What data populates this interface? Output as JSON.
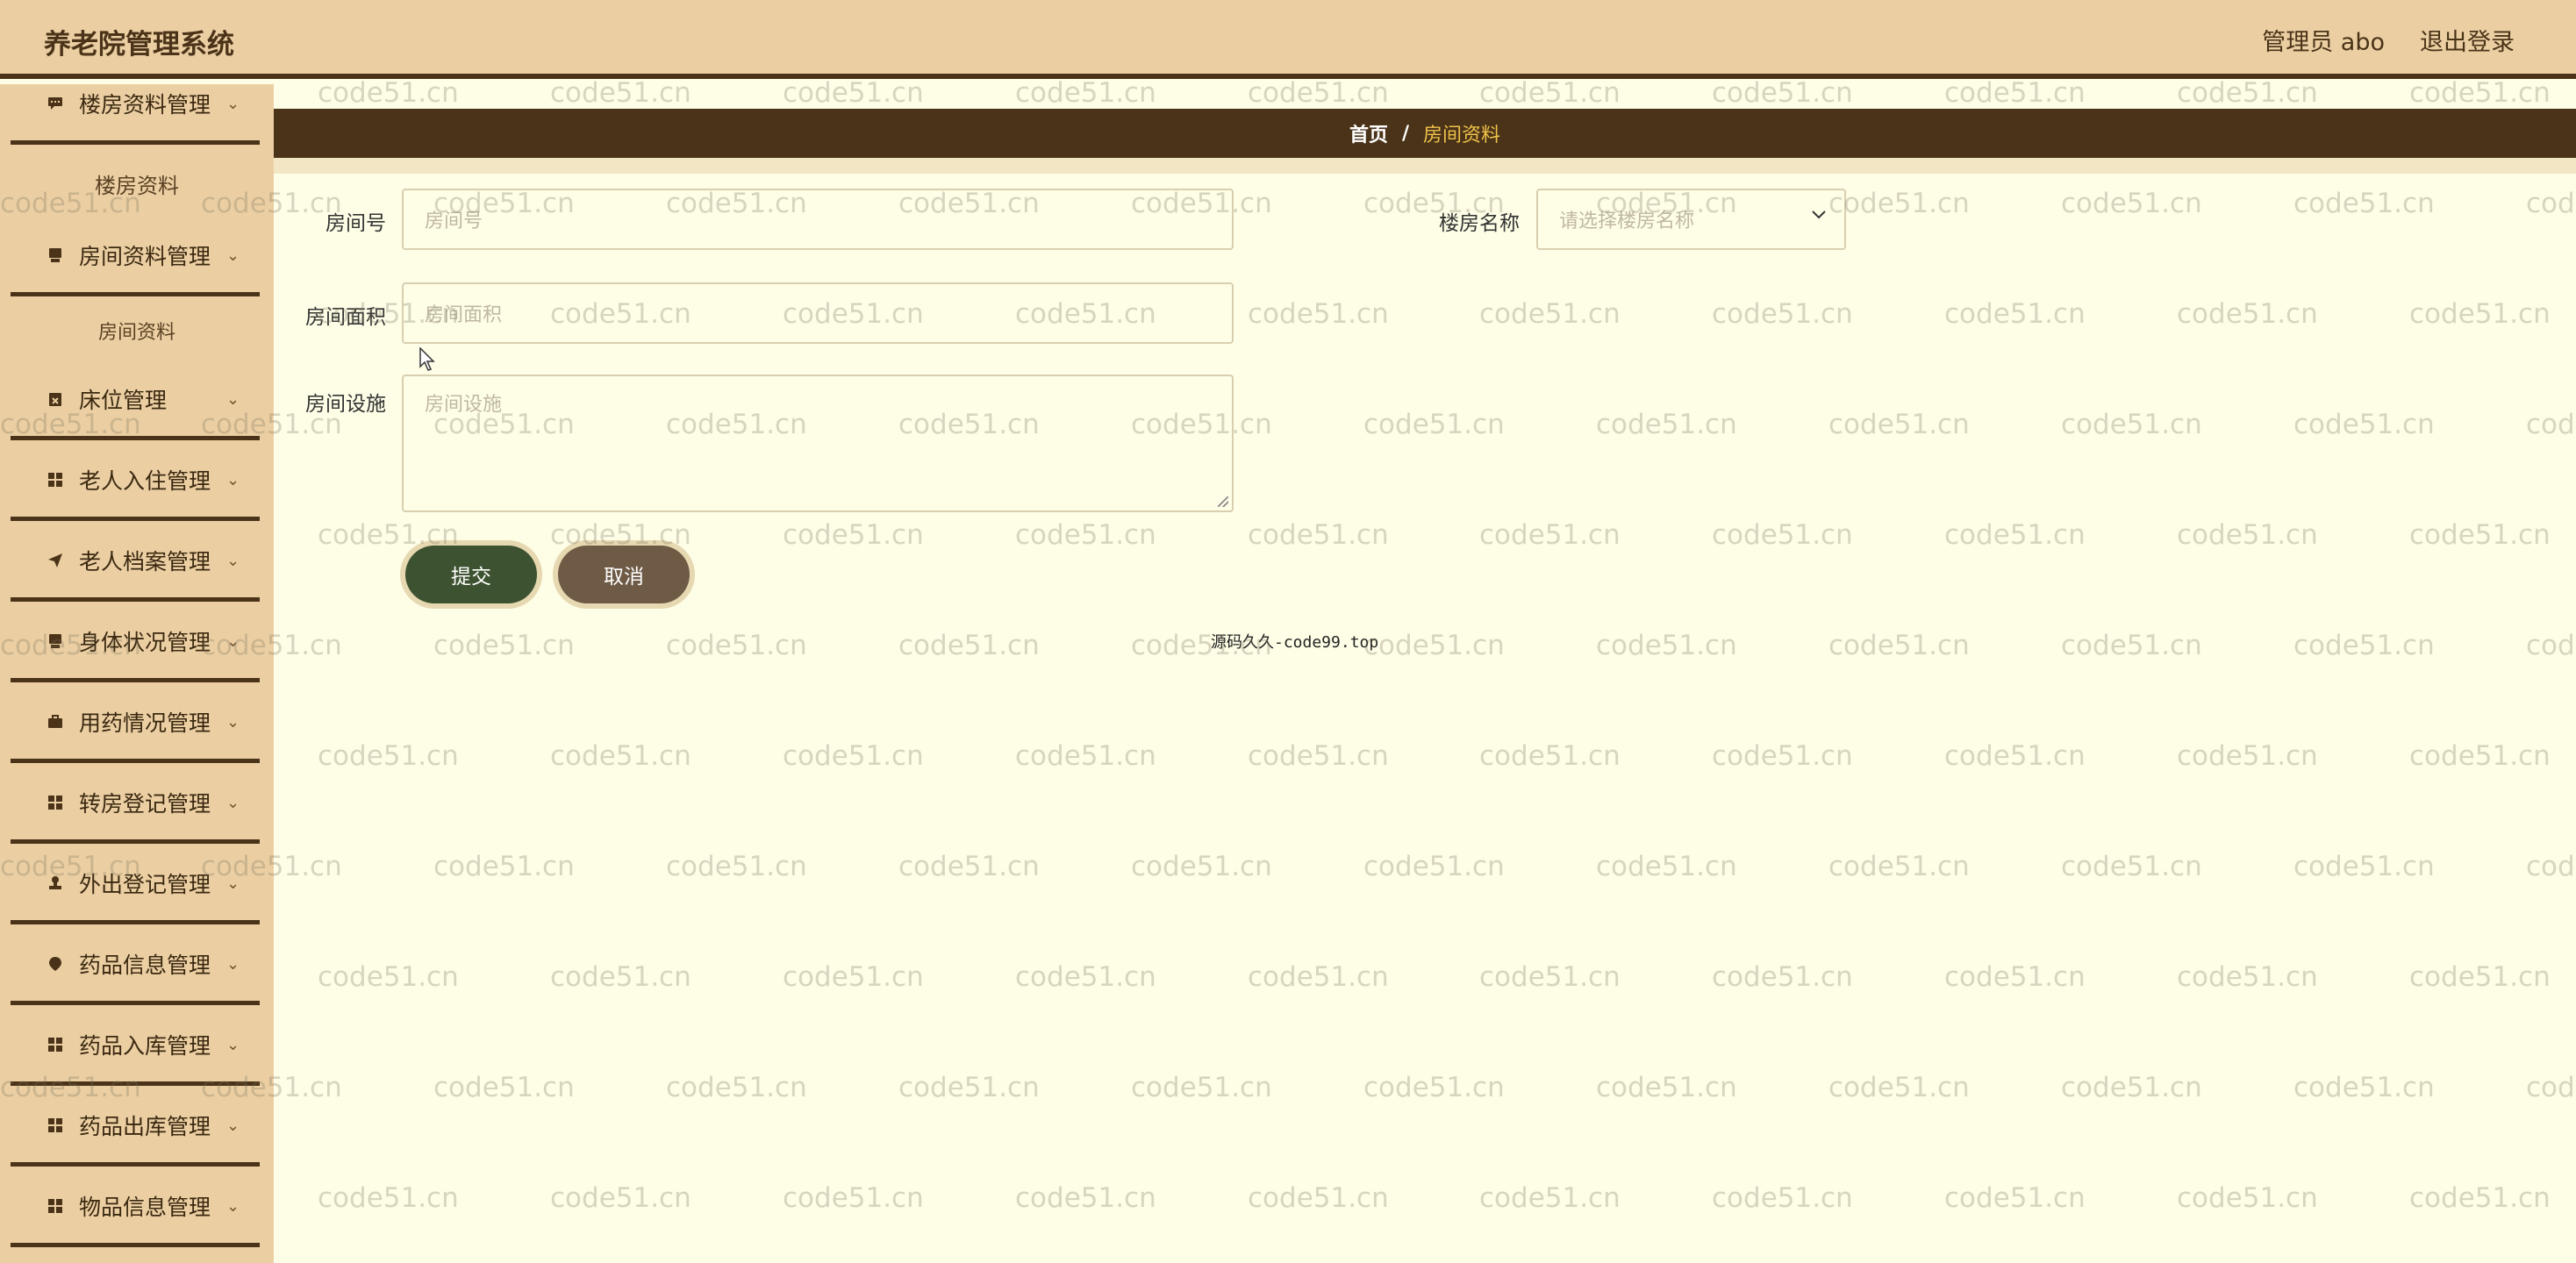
{
  "app": {
    "title": "养老院管理系统",
    "user_label": "管理员 abo",
    "logout_label": "退出登录"
  },
  "sidebar": {
    "items": [
      {
        "label": "楼房资料管理",
        "icon": "chat-bubble-icon"
      },
      {
        "label": "房间资料管理",
        "icon": "inbox-icon"
      },
      {
        "label": "床位管理",
        "icon": "calendar-x-icon"
      },
      {
        "label": "老人入住管理",
        "icon": "grid-icon"
      },
      {
        "label": "老人档案管理",
        "icon": "send-icon"
      },
      {
        "label": "身体状况管理",
        "icon": "inbox-icon"
      },
      {
        "label": "用药情况管理",
        "icon": "briefcase-icon"
      },
      {
        "label": "转房登记管理",
        "icon": "grid-icon"
      },
      {
        "label": "外出登记管理",
        "icon": "stamp-icon"
      },
      {
        "label": "药品信息管理",
        "icon": "pin-icon"
      },
      {
        "label": "药品入库管理",
        "icon": "grid-icon"
      },
      {
        "label": "药品出库管理",
        "icon": "grid-icon"
      },
      {
        "label": "物品信息管理",
        "icon": "grid-icon"
      }
    ],
    "submenus": {
      "building": "楼房资料",
      "room": "房间资料"
    }
  },
  "breadcrumb": {
    "home": "首页",
    "separator": "/",
    "current": "房间资料"
  },
  "form": {
    "room_no_label": "房间号",
    "room_no_placeholder": "房间号",
    "building_label": "楼房名称",
    "building_placeholder": "请选择楼房名称",
    "area_label": "房间面积",
    "area_placeholder": "房间面积",
    "facilities_label": "房间设施",
    "facilities_placeholder": "房间设施",
    "submit_label": "提交",
    "cancel_label": "取消"
  },
  "footer_note": "源码久久-code99.top",
  "watermark_text": "code51.cn",
  "colors": {
    "header_bg": "#ebcfa3",
    "dark_brown": "#4a3318",
    "page_bg": "#fefde6",
    "accent_yellow": "#f0c24a",
    "submit_green": "#3d5230",
    "cancel_brown": "#6e5a45"
  }
}
